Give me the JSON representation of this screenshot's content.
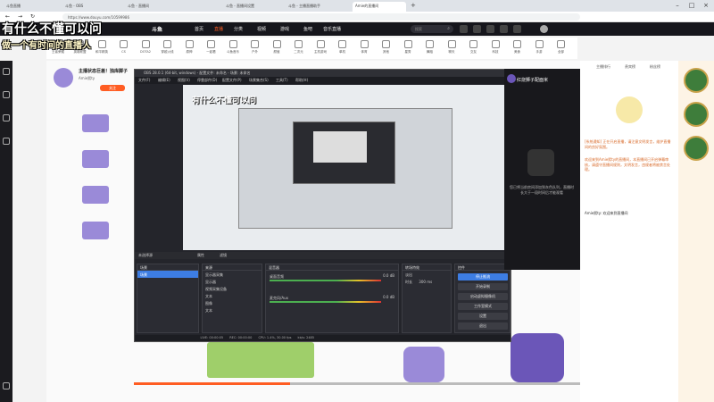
{
  "browser": {
    "tabs": [
      {
        "label": "斗鱼直播"
      },
      {
        "label": "斗鱼 - OBS"
      },
      {
        "label": "斗鱼 - 直播间"
      },
      {
        "label": "斗鱼 - 直播间设置"
      },
      {
        "label": "斗鱼 - 主播直播助手"
      },
      {
        "label": "Amie的直播间"
      }
    ],
    "address": "https://www.douyu.com/10599986",
    "new_tab": "+"
  },
  "site": {
    "logo": "斗鱼",
    "nav": [
      "首页",
      "直播",
      "分类",
      "视频",
      "游戏",
      "鱼吧",
      "音乐直播"
    ],
    "nav_active": 1,
    "search_placeholder": "搜索"
  },
  "categories": [
    "王者荣耀",
    "英雄联盟",
    "和平精英",
    "CS",
    "DOTA2",
    "穿越火线",
    "原神",
    "一起看",
    "斗鱼音乐",
    "户外",
    "颜值",
    "二次元",
    "主机游戏",
    "单机",
    "体育",
    "其他",
    "星秀",
    "舞蹈",
    "聊天",
    "交友",
    "科技",
    "美食",
    "手游",
    "全部"
  ],
  "stream": {
    "title": "主播状态巨差！独库脚子",
    "streamer": "Amie熙ty",
    "follow": "关注"
  },
  "caption": {
    "line1": "有什么不懂可以问",
    "line2": "做一个有时间的直播人"
  },
  "obs": {
    "title": "OBS 28.0.1 (64-bit, windows) - 配置文件: 未命名 - 场景: 未命名",
    "menu": [
      "文件(F)",
      "编辑(E)",
      "视图(V)",
      "停靠部件(D)",
      "配置文件(P)",
      "场景集合(S)",
      "工具(T)",
      "帮助(H)"
    ],
    "source_bar": {
      "no_source": "未选择源",
      "props": "属性",
      "filters": "滤镜"
    },
    "docks": {
      "scenes": {
        "title": "场景",
        "items": [
          "场景"
        ]
      },
      "sources": {
        "title": "来源",
        "items": [
          "显示器采集",
          "显示器",
          "视频采集设备",
          "文本",
          "图像",
          "文本"
        ]
      },
      "mixer": {
        "title": "混音器",
        "rows": [
          {
            "label": "桌面音频",
            "db": "0.0 dB"
          },
          {
            "label": "麦克风/Aux",
            "db": "0.0 dB"
          }
        ]
      },
      "transitions": {
        "title": "转场特效",
        "type": "淡出",
        "duration_label": "时长",
        "duration": "300 ms"
      },
      "controls": {
        "title": "控件",
        "buttons": [
          "停止推流",
          "开始录制",
          "启动虚拟摄像机",
          "工作室模式",
          "设置",
          "退出"
        ]
      }
    },
    "status": {
      "live": "LIVE: 00:00:05",
      "rec": "REC: 00:00:00",
      "cpu": "CPU: 1.4%, 30.00 fps",
      "kbps": "kb/s: 2485"
    }
  },
  "cam": {
    "name": "红烧狮子配面米",
    "hint": "您已将当前房间添加到灰色队列，直播时长大于一段时间后才能观看"
  },
  "chat": {
    "tabs": [
      "主播排行",
      "贵宾榜",
      "粉丝榜"
    ],
    "messages": [
      {
        "text": "[系统通知] 正在开启直播，请注意文明发言，维护直播间的良好氛围。",
        "user": false
      },
      {
        "text": "欢迎来到Amie熙ty的直播间，本直播间已开启弹幕审核，请遵守直播间规则，文明发言，违规者将被禁言处理。",
        "user": false
      },
      {
        "text": "Amie熙ty: 欢迎来到直播间",
        "user": true
      }
    ]
  }
}
